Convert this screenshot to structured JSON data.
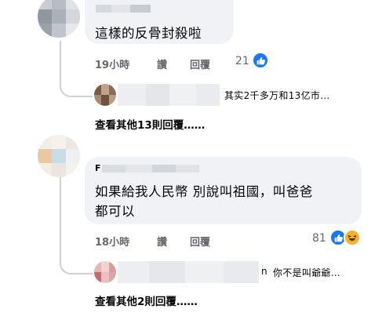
{
  "comment1": {
    "text": "這樣的反骨封殺啦",
    "time": "19小時",
    "like_label": "讚",
    "reply_label": "回覆",
    "reaction_count": "21",
    "reply_preview": "其实2千多万和13亿市…",
    "view_more": "查看其他13則回覆……"
  },
  "comment2": {
    "name_fragment": "F",
    "text_line1": "如果給我人民幣 別說叫祖國，叫爸爸",
    "text_line2": "都可以",
    "time": "18小時",
    "like_label": "讚",
    "reply_label": "回覆",
    "reaction_count": "81",
    "reply_preview_tail": "n",
    "reply_preview": "你不是叫爺爺…",
    "view_more": "查看其他2則回覆……"
  },
  "icons": {
    "like": "thumbs-up-icon",
    "haha": "haha-emoji-icon"
  },
  "colors": {
    "bubble": "#f0f2f5",
    "like_blue": "#1877f2",
    "meta_gray": "#65676b"
  }
}
